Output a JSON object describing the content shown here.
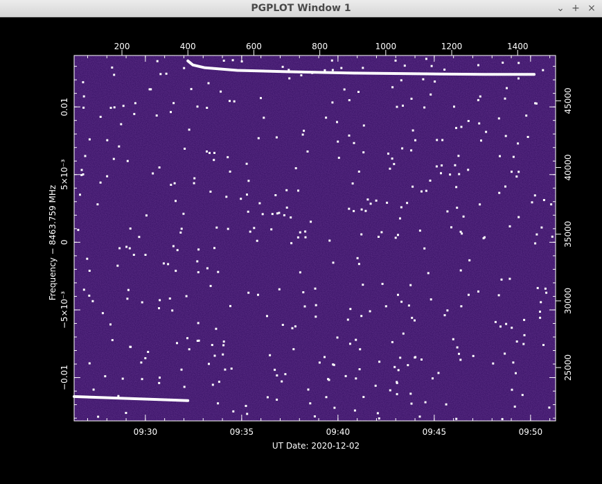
{
  "window": {
    "title": "PGPLOT Window 1",
    "minimize_icon": "minimize-icon",
    "maximize_icon": "maximize-icon",
    "close_icon": "close-icon"
  },
  "chart_data": {
    "type": "heatmap",
    "title": "",
    "xlabel": "UT Date: 2020-12-02",
    "ylabel": "Frequency − 8463.759 MHz",
    "x_bottom_ticks": [
      "09:30",
      "09:35",
      "09:40",
      "09:45",
      "09:50"
    ],
    "x_top_ticks": [
      "200",
      "400",
      "600",
      "800",
      "1000",
      "1200",
      "1400"
    ],
    "y_left_ticks": [
      "−0.01",
      "−5×10⁻³",
      "0",
      "5×10⁻³",
      "0.01"
    ],
    "y_right_ticks": [
      "25000",
      "30000",
      "35000",
      "40000",
      "45000"
    ],
    "x_top_range": [
      55,
      1515
    ],
    "x_bottom_range_minutes": [
      "09:26.3",
      "09:51.3"
    ],
    "y_left_range": [
      -0.0132,
      0.0138
    ],
    "y_right_range": [
      21000,
      48400
    ],
    "background_color": "#3b1468",
    "trace_color": "#ffffff",
    "traces": [
      {
        "segment": "before step",
        "x_top": [
          55,
          400
        ],
        "freq": [
          -0.0114,
          -0.0117
        ]
      },
      {
        "segment": "after step",
        "x_top": [
          400,
          415,
          450,
          550,
          700,
          900,
          1100,
          1300,
          1450
        ],
        "freq": [
          0.0134,
          0.0131,
          0.0129,
          0.0127,
          0.0126,
          0.0125,
          0.01245,
          0.0124,
          0.0124
        ]
      }
    ]
  }
}
